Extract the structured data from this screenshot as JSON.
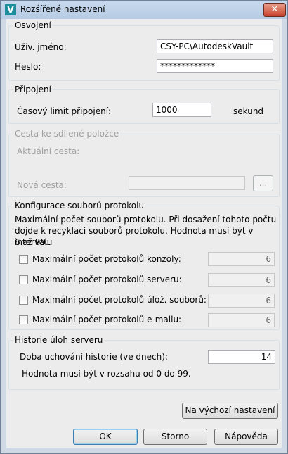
{
  "window": {
    "title": "Rozšířené nastavení",
    "app_icon_glyph": "V",
    "close_glyph": "✕",
    "app_icon": "autodesk-vault-icon"
  },
  "credentials": {
    "legend": "Osvojení",
    "username_label": "Uživ. jméno:",
    "username_value": "CSY-PC\\AutodeskVault",
    "password_label": "Heslo:",
    "password_value": "*************"
  },
  "connection": {
    "legend": "Připojení",
    "timeout_label": "Časový limit připojení:",
    "timeout_value": "1000",
    "timeout_unit": "sekund"
  },
  "shared_path": {
    "legend": "Cesta ke sdílené položce",
    "current_label": "Aktuální cesta:",
    "new_label": "Nová cesta:",
    "new_value": "",
    "browse_label": "..."
  },
  "logs": {
    "legend": "Konfigurace souborů protokolu",
    "description": [
      "Maximální počet souborů protokolu. Při dosažení tohoto počtu",
      "dojde k recyklaci souborů protokolu. Hodnota musí být v intervalu",
      "6 až 99."
    ],
    "rows": [
      {
        "label": "Maximální počet protokolů konzoly:",
        "value": "6",
        "checked": false
      },
      {
        "label": "Maximální počet protokolů serveru:",
        "value": "6",
        "checked": false
      },
      {
        "label": "Maximální počet protokolů úlož. souborů:",
        "value": "6",
        "checked": false
      },
      {
        "label": "Maximální počet protokolů e-mailu:",
        "value": "6",
        "checked": false
      }
    ]
  },
  "history": {
    "legend": "Historie úloh serveru",
    "retention_label": "Doba uchování historie (ve dnech):",
    "retention_value": "14",
    "range_note": "Hodnota musí být v rozsahu od 0 do 99."
  },
  "buttons": {
    "defaults": "Na výchozí nastavení",
    "ok": "OK",
    "cancel": "Storno",
    "help": "Nápověda"
  }
}
